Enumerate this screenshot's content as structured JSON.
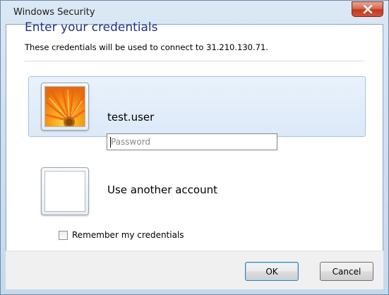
{
  "window": {
    "title": "Windows Security"
  },
  "dialog": {
    "heading": "Enter your credentials",
    "subtext": "These credentials will be used to connect to 31.210.130.71."
  },
  "current_user": {
    "name": "test.user",
    "password_value": "",
    "password_placeholder": "Password",
    "avatar_icon": "flower-avatar-icon"
  },
  "other_account": {
    "label": "Use another account",
    "avatar_icon": "blank-avatar-icon"
  },
  "remember": {
    "label": "Remember my credentials",
    "checked": false
  },
  "buttons": {
    "ok": "OK",
    "cancel": "Cancel"
  },
  "colors": {
    "heading": "#1e3287",
    "selected_tile": "#dce9f8",
    "close_button": "#c2391f"
  }
}
